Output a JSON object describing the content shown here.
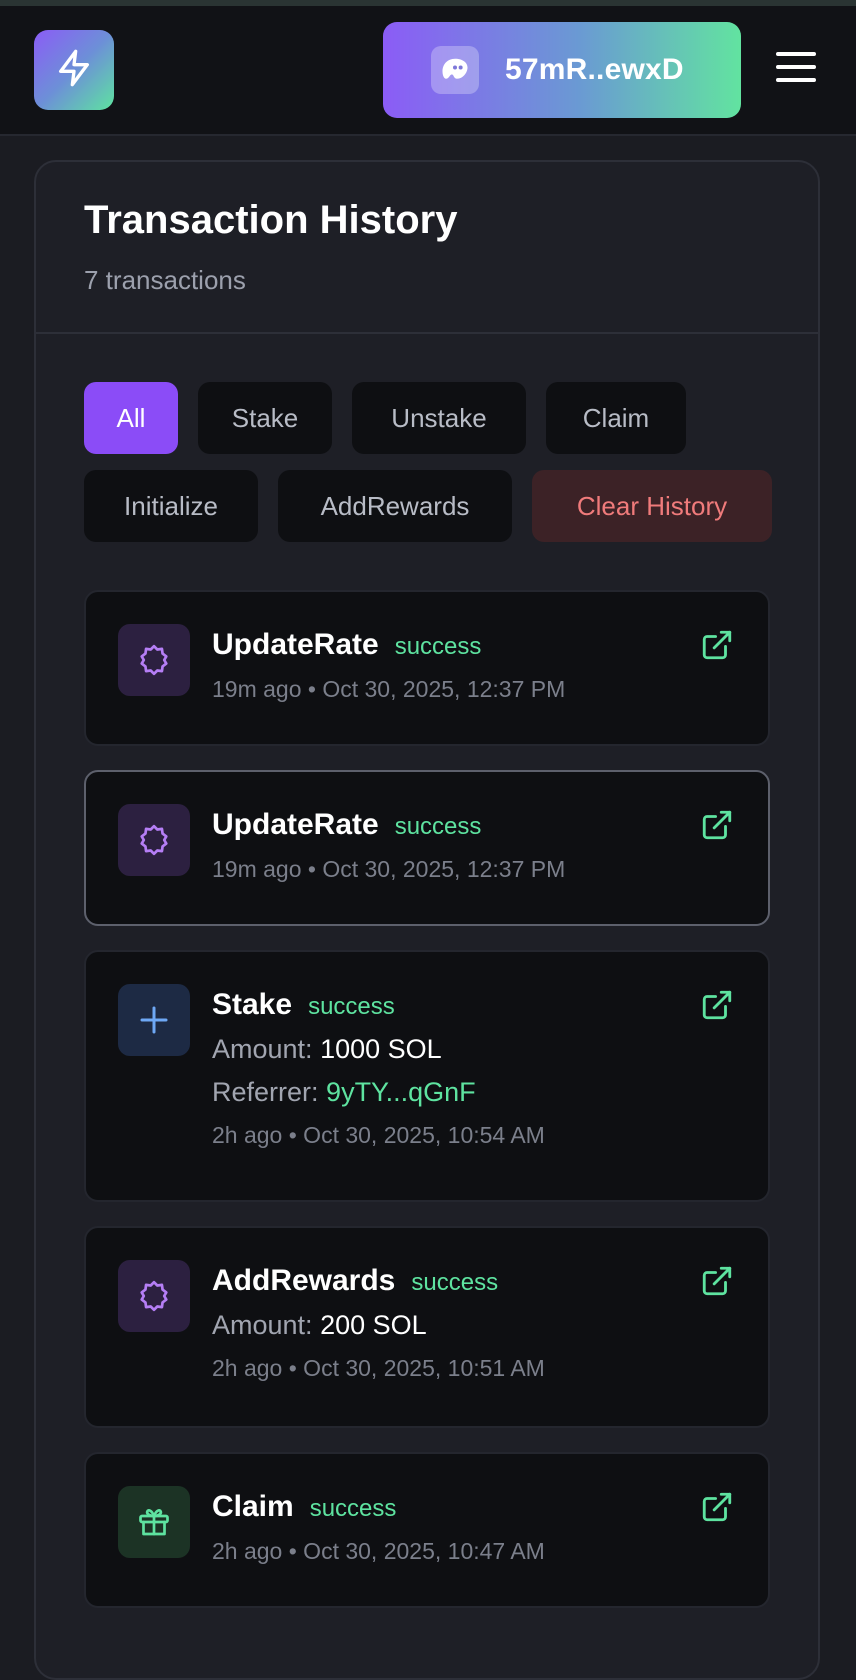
{
  "header": {
    "wallet_label": "57mR..ewxD"
  },
  "panel": {
    "title": "Transaction History",
    "count_text": "7 transactions"
  },
  "filters": {
    "all": "All",
    "stake": "Stake",
    "unstake": "Unstake",
    "claim": "Claim",
    "initialize": "Initialize",
    "addrewards": "AddRewards",
    "clear": "Clear History"
  },
  "colors": {
    "accent_purple": "#8b4cf7",
    "success_green": "#5ee3a0",
    "danger_red": "#f07b7b"
  },
  "transactions": [
    {
      "type": "UpdateRate",
      "status": "success",
      "icon": "settings-gear-icon",
      "time": "19m ago • Oct 30, 2025, 12:37 PM"
    },
    {
      "type": "UpdateRate",
      "status": "success",
      "icon": "settings-gear-icon",
      "time": "19m ago • Oct 30, 2025, 12:37 PM"
    },
    {
      "type": "Stake",
      "status": "success",
      "icon": "plus-icon",
      "amount_label": "Amount:",
      "amount": "1000 SOL",
      "referrer_label": "Referrer:",
      "referrer": "9yTY...qGnF",
      "time": "2h ago • Oct 30, 2025, 10:54 AM"
    },
    {
      "type": "AddRewards",
      "status": "success",
      "icon": "settings-gear-icon",
      "amount_label": "Amount:",
      "amount": "200 SOL",
      "time": "2h ago • Oct 30, 2025, 10:51 AM"
    },
    {
      "type": "Claim",
      "status": "success",
      "icon": "gift-icon",
      "time": "2h ago • Oct 30, 2025, 10:47 AM"
    }
  ]
}
